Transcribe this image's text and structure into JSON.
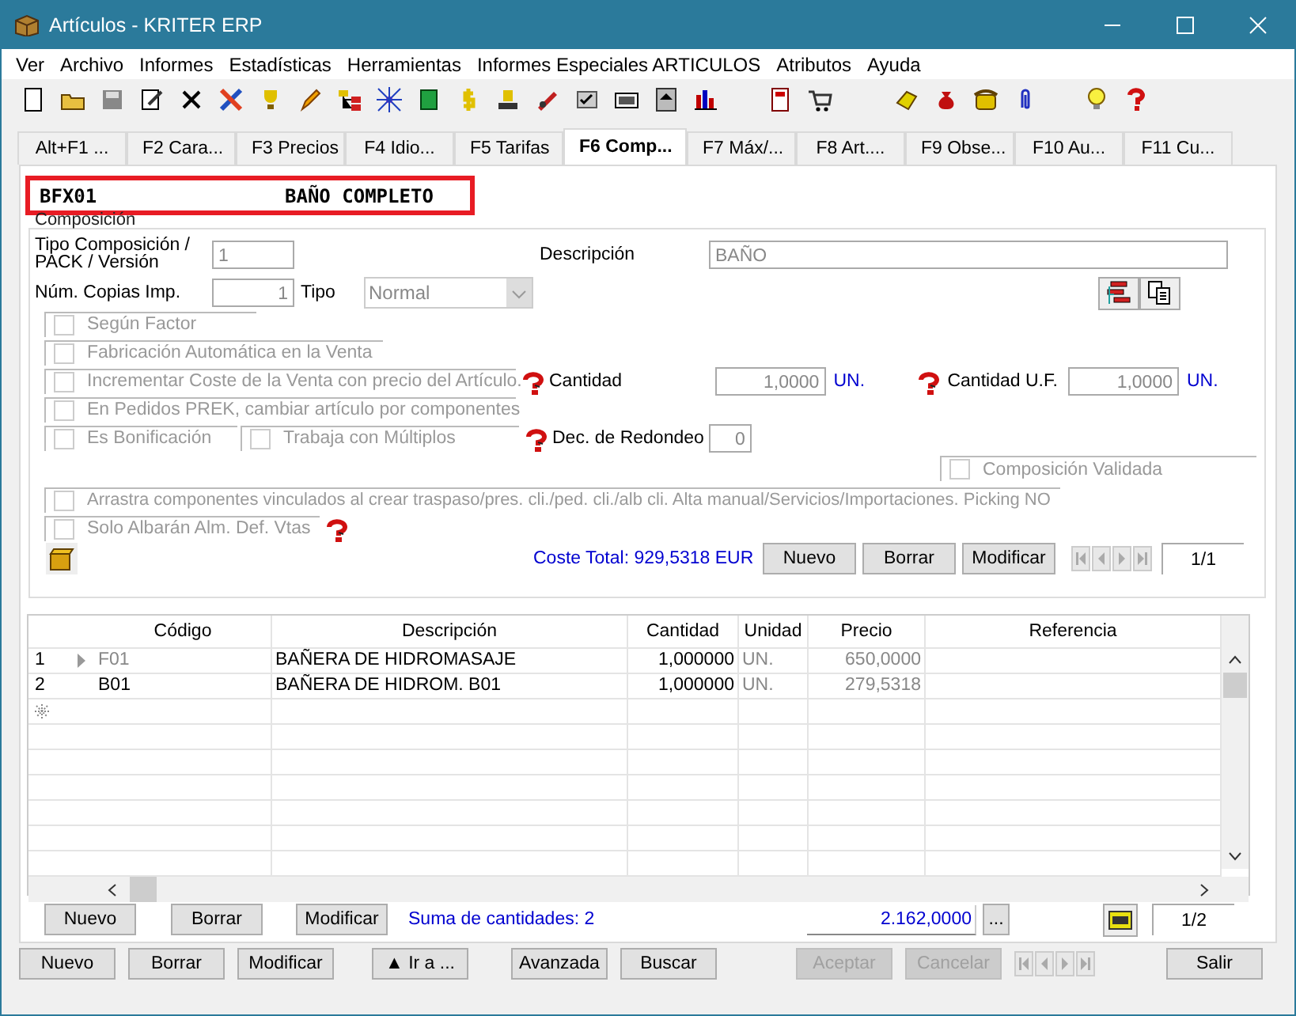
{
  "window": {
    "title": "Artículos - KRITER ERP"
  },
  "menu": [
    "Ver",
    "Archivo",
    "Informes",
    "Estadísticas",
    "Herramientas",
    "Informes Especiales ARTICULOS",
    "Atributos",
    "Ayuda"
  ],
  "tabs": [
    {
      "label": "Alt+F1 ...",
      "selected": false
    },
    {
      "label": "F2 Cara...",
      "selected": false
    },
    {
      "label": "F3 Precios",
      "selected": false
    },
    {
      "label": "F4 Idio...",
      "selected": false
    },
    {
      "label": "F5 Tarifas",
      "selected": false
    },
    {
      "label": "F6 Comp...",
      "selected": true
    },
    {
      "label": "F7 Máx/...",
      "selected": false
    },
    {
      "label": "F8 Art....",
      "selected": false
    },
    {
      "label": "F9 Obse...",
      "selected": false
    },
    {
      "label": "F10 Au...",
      "selected": false
    },
    {
      "label": "F11 Cu...",
      "selected": false
    }
  ],
  "header": {
    "code": "BFX01",
    "name": "BAÑO COMPLETO"
  },
  "composition": {
    "group_label": "Composición",
    "tipo_composicion": {
      "label": "Tipo Composición / PACK / Versión",
      "value": "1"
    },
    "copias": {
      "label": "Núm. Copias Imp.",
      "value": "1"
    },
    "tipo": {
      "label": "Tipo",
      "value": "Normal"
    },
    "descripcion": {
      "label": "Descripción",
      "value": "BAÑO"
    },
    "checks": [
      {
        "label": "Según Factor",
        "checked": false
      },
      {
        "label": "Fabricación Automática en la Venta",
        "checked": false
      },
      {
        "label": "Incrementar Coste de la Venta con precio del Artículo.",
        "checked": false
      },
      {
        "label": "En Pedidos PREK, cambiar artículo por componentes",
        "checked": false
      },
      {
        "label": "Es Bonificación",
        "checked": false
      },
      {
        "label": "Trabaja con Múltiplos",
        "checked": false
      }
    ],
    "cantidad": {
      "label": "Cantidad",
      "value": "1,0000",
      "unit": "UN."
    },
    "cantidad_uf": {
      "label": "Cantidad U.F.",
      "value": "1,0000",
      "unit": "UN."
    },
    "dec_redondeo": {
      "label": "Dec. de Redondeo",
      "value": "0"
    },
    "validada": {
      "label": "Composición Validada",
      "checked": false
    },
    "arrastra": {
      "label": "Arrastra componentes vinculados al crear traspaso/pres. cli./ped. cli./alb cli. Alta manual/Servicios/Importaciones. Picking NO",
      "checked": false
    },
    "solo_albaran": {
      "label": "Solo Albarán Alm. Def. Vtas",
      "checked": false
    },
    "coste_total": "Coste Total: 929,5318 EUR",
    "buttons": [
      "Nuevo",
      "Borrar",
      "Modificar"
    ],
    "pager": "1/1"
  },
  "grid": {
    "columns": [
      "Código",
      "Descripción",
      "Cantidad",
      "Unidad",
      "Precio",
      "Referencia"
    ],
    "rows": [
      {
        "number": "1",
        "current": true,
        "cells": [
          "F01",
          "BAÑERA DE HIDROMASAJE",
          "1,000000",
          "UN.",
          "650,0000",
          ""
        ]
      },
      {
        "number": "2",
        "current": false,
        "cells": [
          "B01",
          "BAÑERA DE HIDROM. B01",
          "1,000000",
          "UN.",
          "279,5318",
          ""
        ]
      }
    ],
    "buttons": [
      "Nuevo",
      "Borrar",
      "Modificar"
    ],
    "sum": "Suma de cantidades: 2",
    "total": "2.162,0000",
    "more": "...",
    "pager": "1/2"
  },
  "bottom_buttons": [
    {
      "label": "Nuevo",
      "disabled": false
    },
    {
      "label": "Borrar",
      "disabled": false
    },
    {
      "label": "Modificar",
      "disabled": false
    },
    {
      "label": "▲ Ir a ...",
      "disabled": false
    },
    {
      "label": "Avanzada",
      "disabled": false
    },
    {
      "label": "Buscar",
      "disabled": false
    },
    {
      "label": "Aceptar",
      "disabled": true
    },
    {
      "label": "Cancelar",
      "disabled": true
    },
    {
      "label": "Salir",
      "disabled": false
    }
  ]
}
